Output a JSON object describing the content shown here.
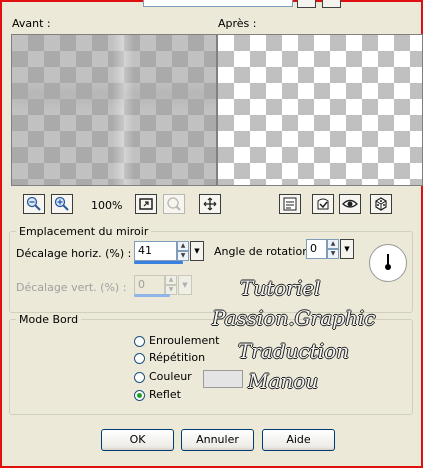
{
  "preview": {
    "before_label": "Avant :",
    "after_label": "Après :",
    "zoom": "100%"
  },
  "mirror": {
    "title": "Emplacement du miroir",
    "horiz_label": "Décalage horiz. (%) :",
    "horiz_value": "41",
    "horiz_slider_fraction": 0.41,
    "vert_label": "Décalage vert. (%) :",
    "vert_value": "0",
    "angle_label": "Angle de rotation :",
    "angle_value": "0"
  },
  "edge": {
    "title": "Mode Bord",
    "options": [
      "Enroulement",
      "Répétition",
      "Couleur",
      "Reflet"
    ],
    "selected": "Reflet"
  },
  "buttons": {
    "ok": "OK",
    "cancel": "Annuler",
    "help": "Aide"
  },
  "watermark": {
    "line1": "Tutoriel",
    "line2": "Passion.Graphic",
    "line3": "Traduction",
    "line4": "Manou"
  },
  "colors": {
    "frame": "#e01010",
    "dialog_bg": "#ece9d8",
    "slider": "#3a80e0"
  },
  "icons": [
    "zoom-out-icon",
    "zoom-in-icon",
    "fit-icon",
    "zoom-disabled-icon",
    "pan-icon",
    "proof-icon",
    "preset-icon",
    "eye-icon",
    "dice-icon"
  ]
}
